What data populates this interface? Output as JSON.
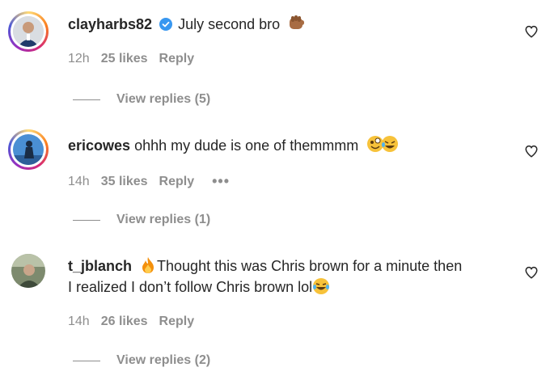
{
  "comments": [
    {
      "username": "clayharbs82",
      "verified": true,
      "text": "July second bro",
      "emoji": "fist-bump-emoji",
      "time": "12h",
      "likes": "25 likes",
      "reply_label": "Reply",
      "view_replies": "View replies (5)",
      "avatar_ring": true
    },
    {
      "username": "ericowes",
      "verified": false,
      "text": "ohhh my dude is one of themmmm",
      "emoji": "zany-and-rofl-emoji",
      "time": "14h",
      "likes": "35 likes",
      "reply_label": "Reply",
      "more_label": "•••",
      "view_replies": "View replies (1)",
      "avatar_ring": true
    },
    {
      "username": "t_jblanch",
      "verified": false,
      "text_line1": "Thought this was Chris brown for a minute then",
      "text_line2": "I realized I don’t follow Chris brown lol",
      "emoji_lead": "fire-emoji",
      "emoji": "joy-emoji",
      "time": "14h",
      "likes": "26 likes",
      "reply_label": "Reply",
      "view_replies": "View replies (2)",
      "avatar_ring": false
    }
  ],
  "colors": {
    "text": "#262626",
    "secondary": "#8e8e8e",
    "verified": "#3897f0"
  }
}
